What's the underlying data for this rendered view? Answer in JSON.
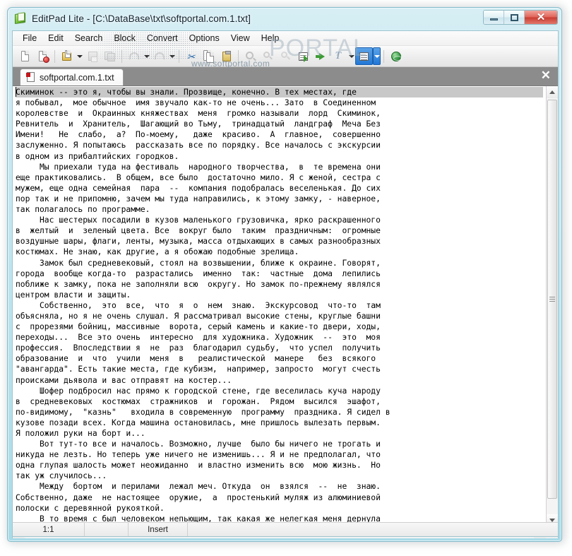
{
  "window": {
    "title": "EditPad Lite - [C:\\DataBase\\txt\\softportal.com.1.txt]",
    "app_icon": "editpad-document-icon",
    "buttons": {
      "minimize": "minimize-icon",
      "maximize": "maximize-icon",
      "close": "✕"
    }
  },
  "menubar": {
    "items": [
      {
        "label": "File"
      },
      {
        "label": "Edit"
      },
      {
        "label": "Search"
      },
      {
        "label": "Block"
      },
      {
        "label": "Convert"
      },
      {
        "label": "Options"
      },
      {
        "label": "View"
      },
      {
        "label": "Help"
      }
    ]
  },
  "toolbar": {
    "buttons": [
      {
        "name": "new-file-icon",
        "enabled": true
      },
      {
        "name": "close-file-icon",
        "enabled": true
      },
      {
        "name": "open-file-icon",
        "enabled": true,
        "dropdown": true
      },
      {
        "name": "save-file-icon",
        "enabled": false
      },
      {
        "name": "save-all-icon",
        "enabled": false
      },
      {
        "name": "undo-icon",
        "enabled": false,
        "dropdown": true
      },
      {
        "name": "redo-icon",
        "enabled": false,
        "dropdown": true
      },
      {
        "name": "cut-icon",
        "enabled": true
      },
      {
        "name": "copy-icon",
        "enabled": true
      },
      {
        "name": "paste-icon",
        "enabled": true
      },
      {
        "name": "find-icon",
        "enabled": false
      },
      {
        "name": "find-next-icon",
        "enabled": false
      },
      {
        "name": "replace-icon",
        "enabled": false
      },
      {
        "name": "go-to-line-icon",
        "enabled": true
      },
      {
        "name": "insert-icon",
        "enabled": true
      },
      {
        "name": "font-icon",
        "enabled": true,
        "dropdown": true
      },
      {
        "name": "print-icon",
        "enabled": true,
        "dropdown": true,
        "selected": true
      },
      {
        "name": "browser-icon",
        "enabled": true
      }
    ]
  },
  "tabs": {
    "items": [
      {
        "label": "softportal.com.1.txt",
        "icon": "text-file-icon",
        "active": true
      }
    ],
    "close_label": "✕"
  },
  "editor": {
    "caret_visible": true,
    "selected_line_index": 0,
    "lines": [
      "Скиминок -- это я, чтобы вы знали. Прозвище, конечно. В тех местах, где",
      "я побывал,  мое обычное  имя звучало как-то не очень... Зато  в Соединенном",
      "королевстве  и  Окраинных княжествах  меня  громко называли  лорд  Скиминок,",
      "Ревнитель  и  Хранитель,  Шагающий во Тьму,  тринадцатый  ландграф  Меча Без",
      "Имени!   Не  слабо,  а?  По-моему,   даже  красиво.  А  главное,  совершенно",
      "заслуженно. Я попытаюсь  рассказать все по порядку. Все началось с экскурсии",
      "в одном из прибалтийских городков.",
      "     Мы приехали туда на фестиваль  народного творчества,  в  те времена они",
      "еще практиковались.  В общем, все было  достаточно мило. Я с женой, сестра с",
      "мужем, еще одна семейная  пара  --  компания подобралась веселенькая. До сих",
      "пор так и не припомню, зачем мы туда направились, к этому замку, - наверное,",
      "так полагалось по программе.",
      "     Нас шестерых посадили в кузов маленького грузовичка, ярко раскрашенного",
      "в  желтый  и  зеленый цвета. Все  вокруг было  таким  праздничным:  огромные",
      "воздушные шары, флаги, ленты, музыка, масса отдыхающих в самых разнообразных",
      "костюмах. Не знаю, как другие, а я обожаю подобные зрелища.",
      "     Замок был средневековый, стоял на возвышении, ближе к окраине. Говорят,",
      "города  вообще когда-то  разрастались  именно  так:  частные  дома  лепились",
      "поближе к замку, пока не заполняли всю  округу. Но замок по-прежнему являлся",
      "центром власти и защиты.",
      "     Собственно,  это  все,  что  я  о  нем  знаю.  Экскурсовод  что-то  там",
      "объясняла, но я не очень слушал. Я рассматривал высокие стены, круглые башни",
      "с  прорезями бойниц, массивные  ворота, серый камень и какие-то двери, ходы,",
      "переходы...  Все это очень  интересно  для художника. Художник  --  это  моя",
      "профессия.  Впоследствии я  не  раз  благодарил судьбу,  что успел  получить",
      "образование  и  что  учили  меня  в   реалистической  манере   без  всякого",
      "\"авангарда\". Есть такие места, где кубизм,  например, запросто  могут счесть",
      "происками дьявола и вас отправят на костер...",
      "     Шофер подбросил нас прямо к городской стене, где веселилась куча народу",
      "в  средневековых  костюмах  стражников  и  горожан.  Рядом  высился  эшафот,",
      "по-видимому,  \"казнь\"   входила в современную  программу  праздника. Я сидел в",
      "кузове позади всех. Когда машина остановилась, мне пришлось вылезать первым.",
      "Я положил руки на борт и...",
      "     Вот тут-то все и началось. Возможно, лучше  было бы ничего не трогать и",
      "никуда не лезть. Но теперь уже ничего не изменишь... Я и не предполагал, что",
      "одна глупая шалость может неожиданно  и властно изменить всю  мою жизнь.  Но",
      "так уж случилось...",
      "     Между  бортом  и перилами  лежал меч. Откуда  он  взялся  --  не  знаю.",
      "Собственно, даже  не настоящее  оружие,  а  простенький муляж из алюминиевой",
      "полоски с деревянной рукояткой.",
      "     В то время с был человеком непьющим, так какая же нелегкая меня дернула"
    ]
  },
  "scrollbars": {
    "vertical": {
      "up": "scroll-up-arrow",
      "down": "scroll-down-arrow",
      "thumb_grip": "scroll-thumb-grip"
    },
    "horizontal": {
      "left": "scroll-left-arrow",
      "right": "scroll-right-arrow"
    }
  },
  "statusbar": {
    "cursor_position": "1:1",
    "blank_cell": "",
    "insert_mode": "Insert",
    "trailing": ""
  },
  "watermark": {
    "big": "PORTAL",
    "small": "www.softportal.com"
  },
  "colors": {
    "frame": "#a9dbe8",
    "close_button": "#c93c31",
    "tab_strip": "#8c8c8c",
    "selection": "#c8c8c8",
    "toolbar_selected": "#2277d6"
  }
}
